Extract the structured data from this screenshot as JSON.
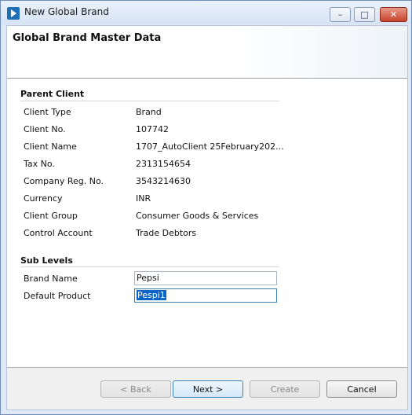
{
  "window": {
    "title": "New Global Brand",
    "buttons": {
      "minimize": "–",
      "maximize": "□",
      "close": "✕"
    }
  },
  "header": {
    "title": "Global Brand Master Data"
  },
  "parent_client": {
    "section_label": "Parent Client",
    "rows": [
      {
        "label": "Client Type",
        "value": "Brand"
      },
      {
        "label": "Client No.",
        "value": "107742"
      },
      {
        "label": "Client Name",
        "value": "1707_AutoClient 25February202..."
      },
      {
        "label": "Tax No.",
        "value": "2313154654"
      },
      {
        "label": "Company Reg. No.",
        "value": "3543214630"
      },
      {
        "label": "Currency",
        "value": "INR"
      },
      {
        "label": "Client Group",
        "value": "Consumer Goods & Services"
      },
      {
        "label": "Control Account",
        "value": "Trade Debtors"
      }
    ]
  },
  "sub_levels": {
    "section_label": "Sub Levels",
    "brand_name": {
      "label": "Brand Name",
      "value": "Pepsi"
    },
    "default_product": {
      "label": "Default Product",
      "value": "Pespi1"
    }
  },
  "footer": {
    "back": "< Back",
    "next": "Next >",
    "create": "Create",
    "cancel": "Cancel"
  }
}
